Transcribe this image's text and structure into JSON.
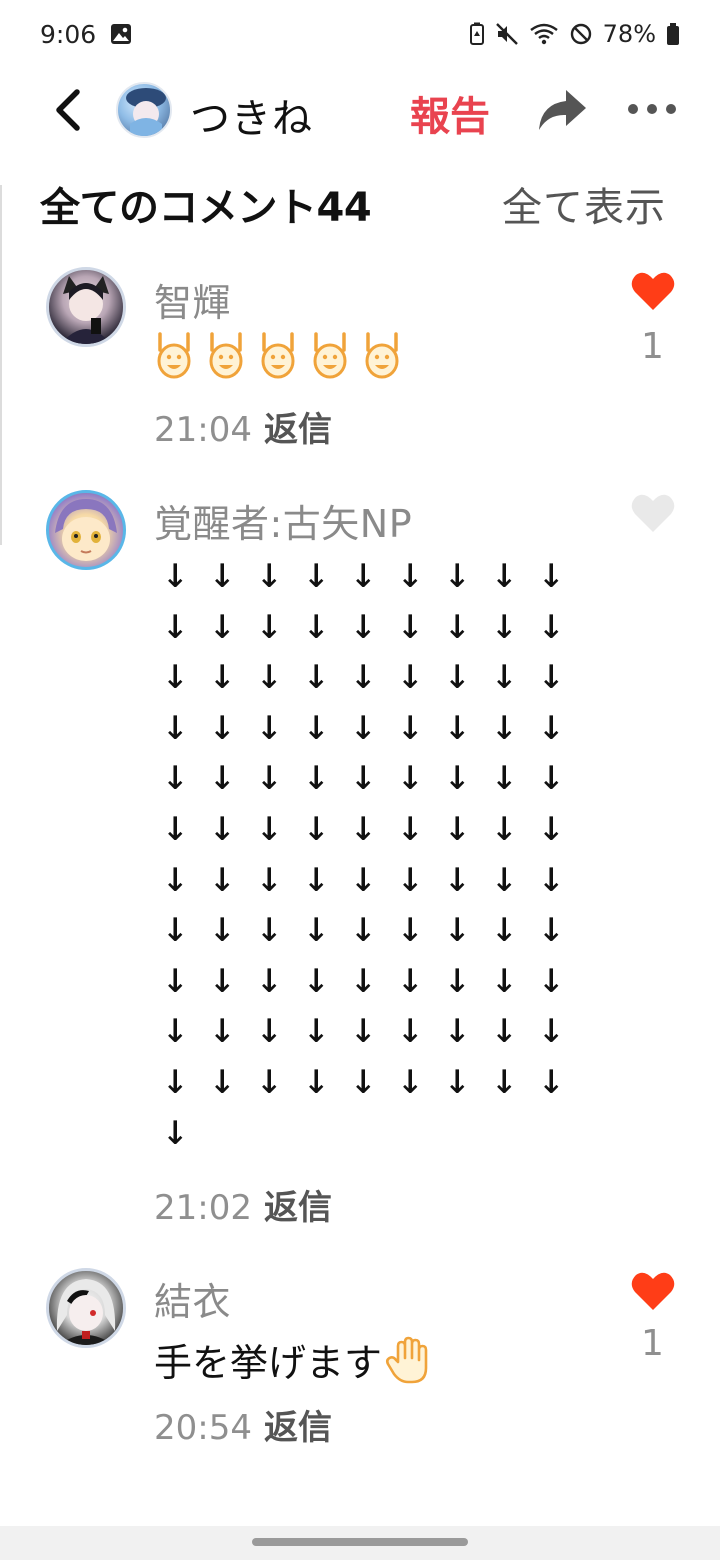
{
  "status_bar": {
    "time": "9:06",
    "battery": "78%",
    "icons": [
      "image-icon",
      "battery-saver-icon",
      "mute-icon",
      "wifi-icon",
      "do-not-disturb-icon",
      "battery-icon"
    ]
  },
  "header": {
    "name": "つきね",
    "report_label": "報告",
    "icons": [
      "back-icon",
      "share-icon",
      "more-icon"
    ]
  },
  "comments_section": {
    "title": "全てのコメント44",
    "show_all_label": "全て表示"
  },
  "comments": [
    {
      "user": "智輝",
      "body_type": "emoji",
      "emoji_name": "raised-hands-face-emoji",
      "emoji_count": 5,
      "time": "21:04",
      "reply_label": "返信",
      "liked": true,
      "like_count": "1",
      "like_color": "#ff3d17"
    },
    {
      "user": "覚醒者:古矢NP",
      "body_type": "arrows",
      "arrow_rows": [
        "↓↓↓↓↓↓↓↓↓",
        "↓↓↓↓↓↓↓↓↓",
        "↓↓↓↓↓↓↓↓↓",
        "↓↓↓↓↓↓↓↓↓",
        "↓↓↓↓↓↓↓↓↓",
        "↓↓↓↓↓↓↓↓↓",
        "↓↓↓↓↓↓↓↓↓",
        "↓↓↓↓↓↓↓↓↓",
        "↓↓↓↓↓↓↓↓↓",
        "↓↓↓↓↓↓↓↓↓",
        "↓↓↓↓↓↓↓↓↓",
        "↓"
      ],
      "time": "21:02",
      "reply_label": "返信",
      "liked": false,
      "like_count": "",
      "like_color": "#e8e8e8"
    },
    {
      "user": "結衣",
      "body_type": "text",
      "body": "手を挙げます",
      "body_emoji": "raised-hand-emoji",
      "time": "20:54",
      "reply_label": "返信",
      "liked": true,
      "like_count": "1",
      "like_color": "#ff3d17"
    }
  ],
  "accent_color": "#e9434f"
}
